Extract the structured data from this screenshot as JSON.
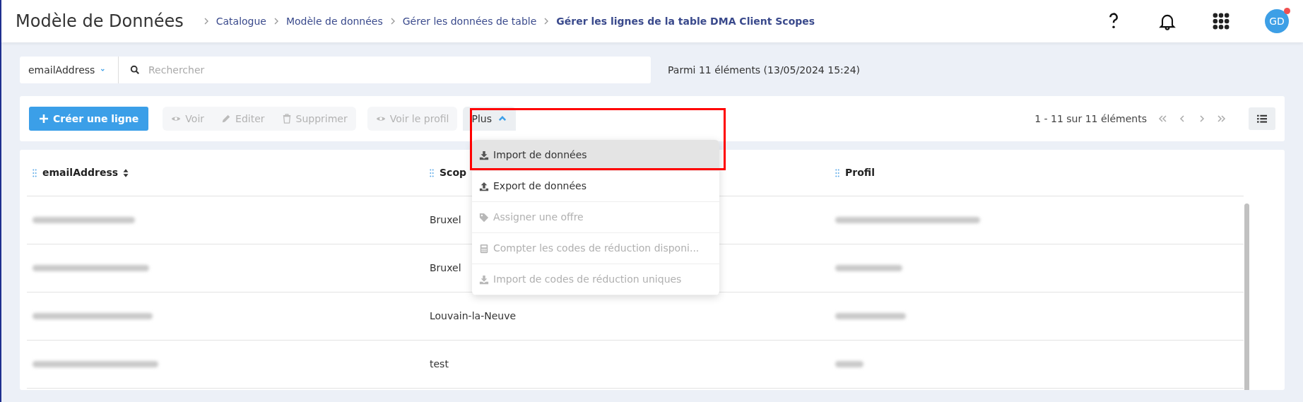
{
  "header": {
    "title": "Modèle de Données",
    "breadcrumb": [
      {
        "label": "Catalogue",
        "current": false
      },
      {
        "label": "Modèle de données",
        "current": false
      },
      {
        "label": "Gérer les données de table",
        "current": false
      },
      {
        "label": "Gérer les lignes de la table DMA Client Scopes",
        "current": true
      }
    ],
    "avatar": {
      "initials": "GD",
      "notification": true
    }
  },
  "search": {
    "field": "emailAddress",
    "placeholder": "Rechercher",
    "summary": "Parmi 11 éléments (13/05/2024 15:24)"
  },
  "toolbar": {
    "buttons": [
      {
        "label": "Créer une ligne",
        "kind": "primary",
        "disabled": false
      },
      {
        "label": "Voir",
        "kind": "group",
        "disabled": true
      },
      {
        "label": "Editer",
        "kind": "group",
        "disabled": true
      },
      {
        "label": "Supprimer",
        "kind": "group",
        "disabled": true
      },
      {
        "label": "Voir le profil",
        "kind": "single",
        "disabled": true
      }
    ],
    "more": {
      "label": "Plus",
      "expanded": true,
      "highlighted": true
    },
    "pagination": "1 - 11 sur 11 éléments"
  },
  "menu": [
    {
      "label": "Import de données",
      "selected": true,
      "disabled": false
    },
    {
      "label": "Export de données",
      "selected": false,
      "disabled": false
    },
    {
      "label": "Assigner une offre",
      "selected": false,
      "disabled": true
    },
    {
      "label": "Compter les codes de réduction disponi...",
      "selected": false,
      "disabled": true
    },
    {
      "label": "Import de codes de réduction uniques",
      "selected": false,
      "disabled": true
    }
  ],
  "table": {
    "columns": [
      "emailAddress",
      "Scop",
      "Profil"
    ],
    "rows": [
      {
        "scope": "Bruxel",
        "blurred": true
      },
      {
        "scope": "Bruxel",
        "blurred": true
      },
      {
        "scope": "Louvain-la-Neuve",
        "blurred": true
      },
      {
        "scope": "test",
        "blurred": true
      }
    ]
  }
}
